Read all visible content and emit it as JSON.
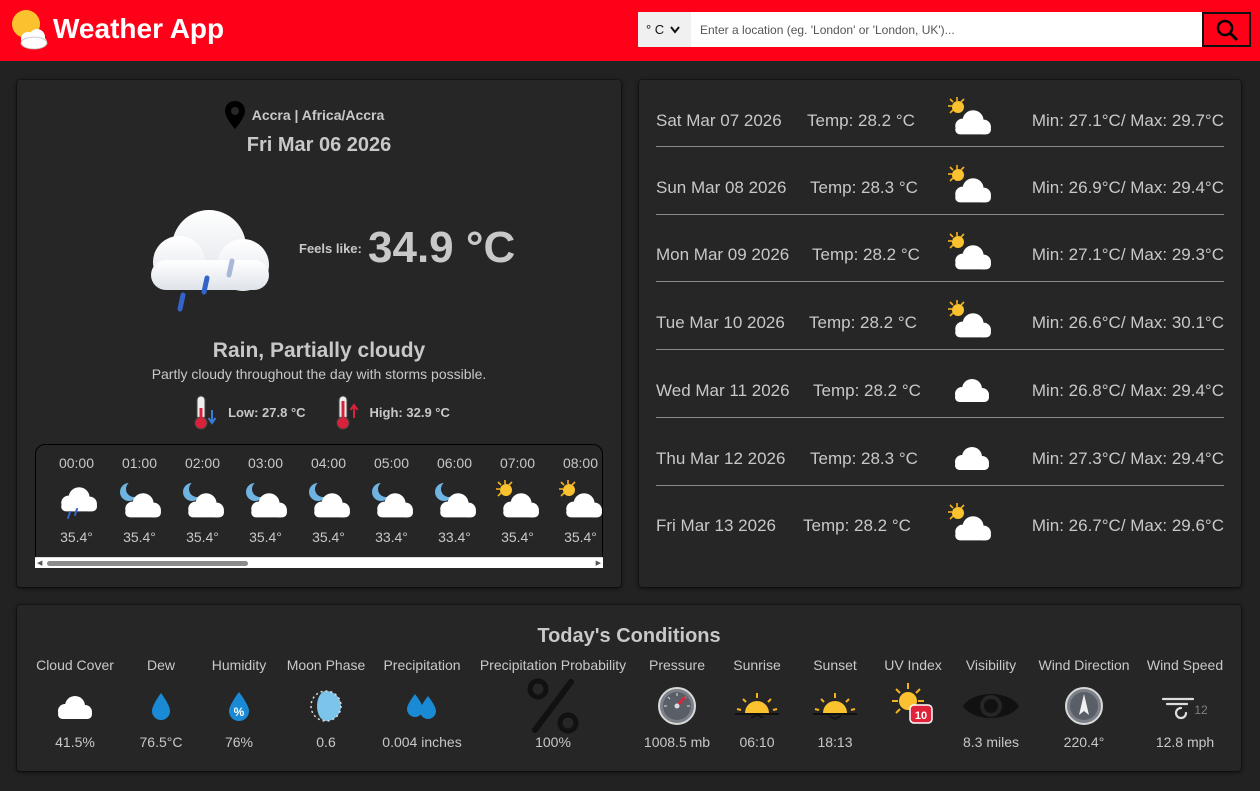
{
  "header": {
    "title": "Weather App",
    "unit_selected": "° C",
    "search_placeholder": "Enter a location (eg. 'London' or 'London, UK')..."
  },
  "current": {
    "location": "Accra | Africa/Accra",
    "date": "Fri Mar 06 2026",
    "feels_label": "Feels like:",
    "temperature": "34.9 °C",
    "condition": "Rain, Partially cloudy",
    "description": "Partly cloudy throughout the day with storms possible.",
    "low": "Low: 27.8 °C",
    "high": "High: 32.9 °C",
    "icon": "rain-cloud-icon"
  },
  "hourly": [
    {
      "time": "00:00",
      "temp": "35.4°",
      "icon": "rain-cloud-icon"
    },
    {
      "time": "01:00",
      "temp": "35.4°",
      "icon": "moon-cloud-icon"
    },
    {
      "time": "02:00",
      "temp": "35.4°",
      "icon": "moon-cloud-icon"
    },
    {
      "time": "03:00",
      "temp": "35.4°",
      "icon": "moon-cloud-icon"
    },
    {
      "time": "04:00",
      "temp": "35.4°",
      "icon": "moon-cloud-icon"
    },
    {
      "time": "05:00",
      "temp": "33.4°",
      "icon": "moon-cloud-icon"
    },
    {
      "time": "06:00",
      "temp": "33.4°",
      "icon": "moon-cloud-icon"
    },
    {
      "time": "07:00",
      "temp": "35.4°",
      "icon": "sun-cloud-icon"
    },
    {
      "time": "08:00",
      "temp": "35.4°",
      "icon": "sun-cloud-icon"
    }
  ],
  "forecast": [
    {
      "date": "Sat Mar 07 2026",
      "temp": "Temp: 28.2 °C",
      "minmax": "Min: 27.1°C/ Max: 29.7°C",
      "icon": "sun-cloud-icon"
    },
    {
      "date": "Sun Mar 08 2026",
      "temp": "Temp: 28.3 °C",
      "minmax": "Min: 26.9°C/ Max: 29.4°C",
      "icon": "sun-cloud-icon"
    },
    {
      "date": "Mon Mar 09 2026",
      "temp": "Temp: 28.2 °C",
      "minmax": "Min: 27.1°C/ Max: 29.3°C",
      "icon": "sun-cloud-icon"
    },
    {
      "date": "Tue Mar 10 2026",
      "temp": "Temp: 28.2 °C",
      "minmax": "Min: 26.6°C/ Max: 30.1°C",
      "icon": "sun-cloud-icon"
    },
    {
      "date": "Wed Mar 11 2026",
      "temp": "Temp: 28.2 °C",
      "minmax": "Min: 26.8°C/ Max: 29.4°C",
      "icon": "cloud-icon"
    },
    {
      "date": "Thu Mar 12 2026",
      "temp": "Temp: 28.3 °C",
      "minmax": "Min: 27.3°C/ Max: 29.4°C",
      "icon": "cloud-icon"
    },
    {
      "date": "Fri Mar 13 2026",
      "temp": "Temp: 28.2 °C",
      "minmax": "Min: 26.7°C/ Max: 29.6°C",
      "icon": "sun-cloud-icon"
    }
  ],
  "conditions": {
    "heading": "Today's Conditions",
    "items": [
      {
        "label": "Cloud Cover",
        "value": "41.5%",
        "icon": "cloud-icon"
      },
      {
        "label": "Dew",
        "value": "76.5°C",
        "icon": "water-drop-icon"
      },
      {
        "label": "Humidity",
        "value": "76%",
        "icon": "humidity-icon"
      },
      {
        "label": "Moon Phase",
        "value": "0.6",
        "icon": "moon-phase-icon"
      },
      {
        "label": "Precipitation",
        "value": "0.004 inches",
        "icon": "raindrops-icon"
      },
      {
        "label": "Precipitation Probability",
        "value": "100%",
        "icon": "percent-icon"
      },
      {
        "label": "Pressure",
        "value": "1008.5 mb",
        "icon": "barometer-icon"
      },
      {
        "label": "Sunrise",
        "value": "06:10",
        "icon": "sunrise-icon"
      },
      {
        "label": "Sunset",
        "value": "18:13",
        "icon": "sunset-icon"
      },
      {
        "label": "UV Index",
        "value": "",
        "badge": "10",
        "icon": "uv-index-icon"
      },
      {
        "label": "Visibility",
        "value": "8.3 miles",
        "icon": "eye-icon"
      },
      {
        "label": "Wind Direction",
        "value": "220.4°",
        "icon": "compass-icon"
      },
      {
        "label": "Wind Speed",
        "value": "12.8 mph",
        "badge": "12",
        "icon": "wind-icon"
      }
    ]
  },
  "colors": {
    "header_bg": "#ff0019",
    "page_bg": "#222222",
    "card_bg": "#262626",
    "text": "#c8c8c8"
  }
}
